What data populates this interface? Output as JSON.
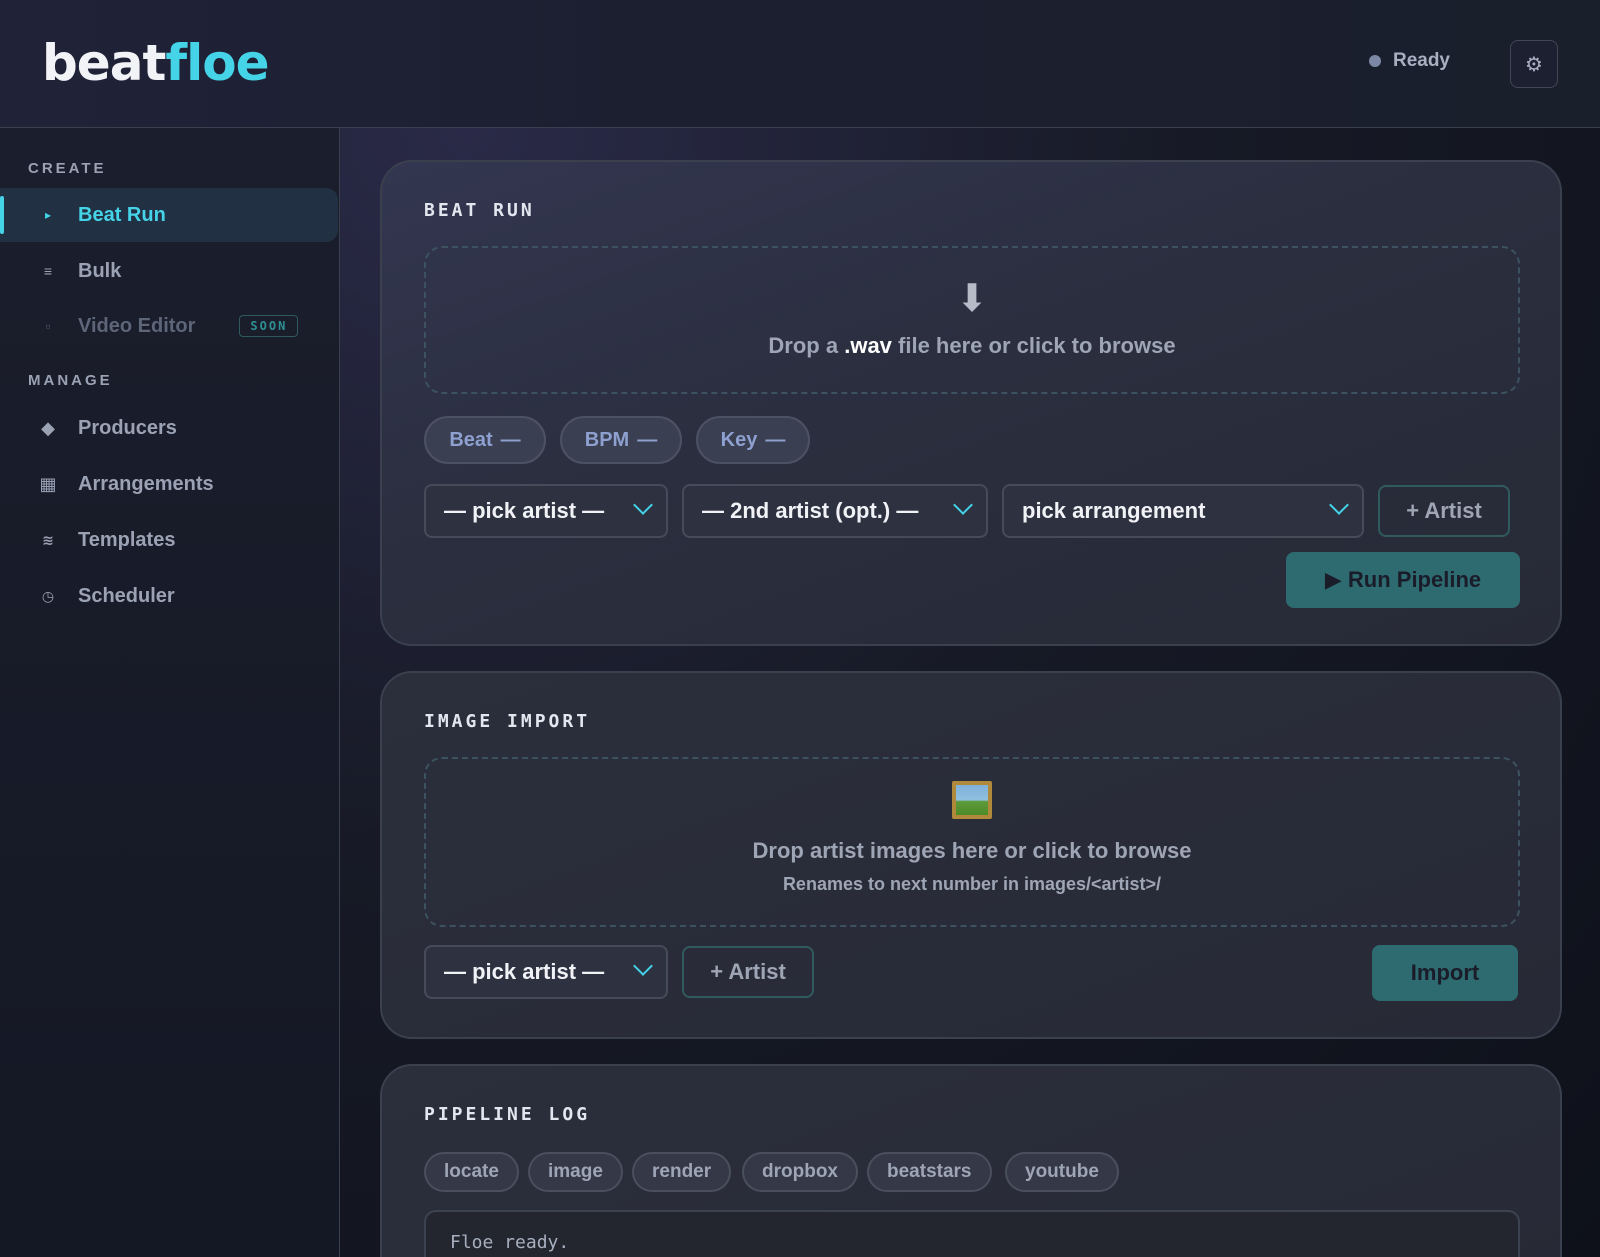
{
  "brand": {
    "part1": "beat",
    "part2": "floe"
  },
  "status": {
    "label": "Ready"
  },
  "settings": {
    "icon": "gear-icon",
    "glyph": "⚙"
  },
  "sidebar": {
    "create_label": "CREATE",
    "manage_label": "MANAGE",
    "items": [
      {
        "label": "Beat Run",
        "icon": "play-icon",
        "glyph": "▸"
      },
      {
        "label": "Bulk",
        "icon": "list-icon",
        "glyph": "≡"
      },
      {
        "label": "Video Editor",
        "icon": "square-icon",
        "glyph": "▫",
        "badge": "SOON"
      },
      {
        "label": "Producers",
        "icon": "diamond-icon",
        "glyph": "◆"
      },
      {
        "label": "Arrangements",
        "icon": "grid-icon",
        "glyph": "▦"
      },
      {
        "label": "Templates",
        "icon": "wave-icon",
        "glyph": "≋"
      },
      {
        "label": "Scheduler",
        "icon": "clock-icon",
        "glyph": "◷"
      }
    ]
  },
  "beat_run": {
    "title": "BEAT RUN",
    "drop_icon": "download-arrow-icon",
    "drop_glyph": "⬇",
    "drop_prefix": "Drop a ",
    "drop_ext": ".wav",
    "drop_suffix": " file here or click to browse",
    "pills": [
      {
        "label": "Beat",
        "value": "—"
      },
      {
        "label": "BPM",
        "value": "—"
      },
      {
        "label": "Key",
        "value": "—"
      }
    ],
    "artist_select": "— pick artist —",
    "artist2_select": "— 2nd artist (opt.) —",
    "arrangement_select": "pick arrangement",
    "add_artist": "+ Artist",
    "run_button": "▶ Run Pipeline"
  },
  "image_import": {
    "title": "IMAGE IMPORT",
    "drop_icon": "framed-picture-icon",
    "drop_text": "Drop artist images here or click to browse",
    "drop_sub": "Renames to next number in images/<artist>/",
    "artist_select": "— pick artist —",
    "add_artist": "+ Artist",
    "import_button": "Import"
  },
  "pipeline_log": {
    "title": "PIPELINE LOG",
    "chips": [
      "locate",
      "image",
      "render",
      "dropbox",
      "beatstars",
      "youtube"
    ],
    "log_text": "Floe ready."
  },
  "colors": {
    "accent": "#45d3e8",
    "primary_button": "#2d6b70",
    "background": "#13161f"
  }
}
